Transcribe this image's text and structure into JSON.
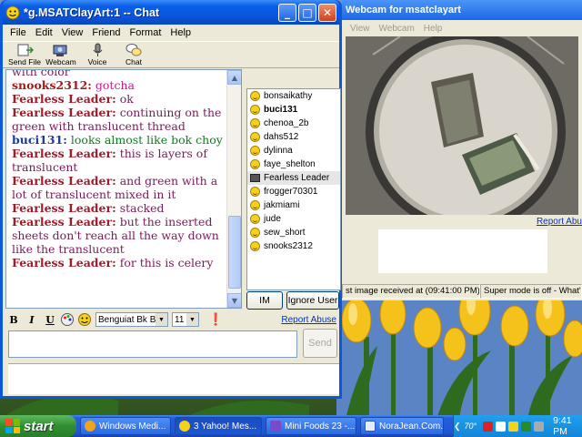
{
  "chat_window": {
    "title": "*g.MSATClayArt:1 -- Chat",
    "controls": [
      "_",
      "□",
      "✕"
    ],
    "menu": [
      "File",
      "Edit",
      "View",
      "Friend",
      "Format",
      "Help"
    ],
    "toolbar": [
      "Send File",
      "Webcam",
      "Voice",
      "Chat"
    ],
    "messages": [
      {
        "who": "",
        "text": "with color",
        "who_class": "c-fl",
        "text_class": "c-txt",
        "cont": true
      },
      {
        "who": "snooks2312:",
        "text": "gotcha",
        "who_class": "c-snook",
        "text_class": "c-snooktxt"
      },
      {
        "who": "Fearless Leader:",
        "text": "ok",
        "who_class": "c-fl",
        "text_class": "c-txt"
      },
      {
        "who": "Fearless Leader:",
        "text": "continuing on the green with translucent thread",
        "who_class": "c-fl",
        "text_class": "c-txt"
      },
      {
        "who": "buci131:",
        "text": "looks almost like bok choy",
        "who_class": "c-buci",
        "text_class": "c-bucitxt"
      },
      {
        "who": "Fearless Leader:",
        "text": "this is layers of translucent",
        "who_class": "c-fl",
        "text_class": "c-txt"
      },
      {
        "who": "Fearless Leader:",
        "text": "and green with a lot of translucent mixed in it",
        "who_class": "c-fl",
        "text_class": "c-txt"
      },
      {
        "who": "Fearless Leader:",
        "text": "stacked",
        "who_class": "c-fl",
        "text_class": "c-txt"
      },
      {
        "who": "Fearless Leader:",
        "text": "but the inserted sheets don't reach all the way down like the translucent",
        "who_class": "c-fl",
        "text_class": "c-txt"
      },
      {
        "who": "Fearless Leader:",
        "text": "for this is celery",
        "who_class": "c-fl",
        "text_class": "c-txt"
      }
    ],
    "users": [
      {
        "name": "bonsaikathy",
        "bold": false,
        "icon": "smiley"
      },
      {
        "name": "buci131",
        "bold": true,
        "icon": "smiley"
      },
      {
        "name": "chenoa_2b",
        "bold": false,
        "icon": "smiley"
      },
      {
        "name": "dahs512",
        "bold": false,
        "icon": "smiley"
      },
      {
        "name": "dylinna",
        "bold": false,
        "icon": "smiley"
      },
      {
        "name": "faye_shelton",
        "bold": false,
        "icon": "smiley"
      },
      {
        "name": "Fearless Leader",
        "bold": false,
        "icon": "webcam",
        "selected": true
      },
      {
        "name": "frogger70301",
        "bold": false,
        "icon": "smiley"
      },
      {
        "name": "jakmiami",
        "bold": false,
        "icon": "smiley"
      },
      {
        "name": "jude",
        "bold": false,
        "icon": "smiley"
      },
      {
        "name": "sew_short",
        "bold": false,
        "icon": "smiley"
      },
      {
        "name": "snooks2312",
        "bold": false,
        "icon": "smiley"
      }
    ],
    "im_label": "IM",
    "ignore_label": "Ignore User",
    "format": {
      "bold": "B",
      "italic": "I",
      "underline": "U",
      "font": "Benguiat Bk BT",
      "size": "11"
    },
    "report_abuse": "Report Abuse",
    "send_label": "Send"
  },
  "webcam_window": {
    "title": "Webcam for msatclayart",
    "menu": [
      "View",
      "Webcam",
      "Help"
    ],
    "report_abuse": "Report Abu",
    "status_left": "st image received at (09:41:00 PM)",
    "status_right": "Super mode is off - What's this"
  },
  "taskbar": {
    "start_label": "start",
    "tasks": [
      "Windows Medi...",
      "3 Yahoo! Mes...",
      "Mini Foods 23 -...",
      "NoraJean.Com..."
    ],
    "temp": "70°",
    "clock": "9:41 PM"
  }
}
